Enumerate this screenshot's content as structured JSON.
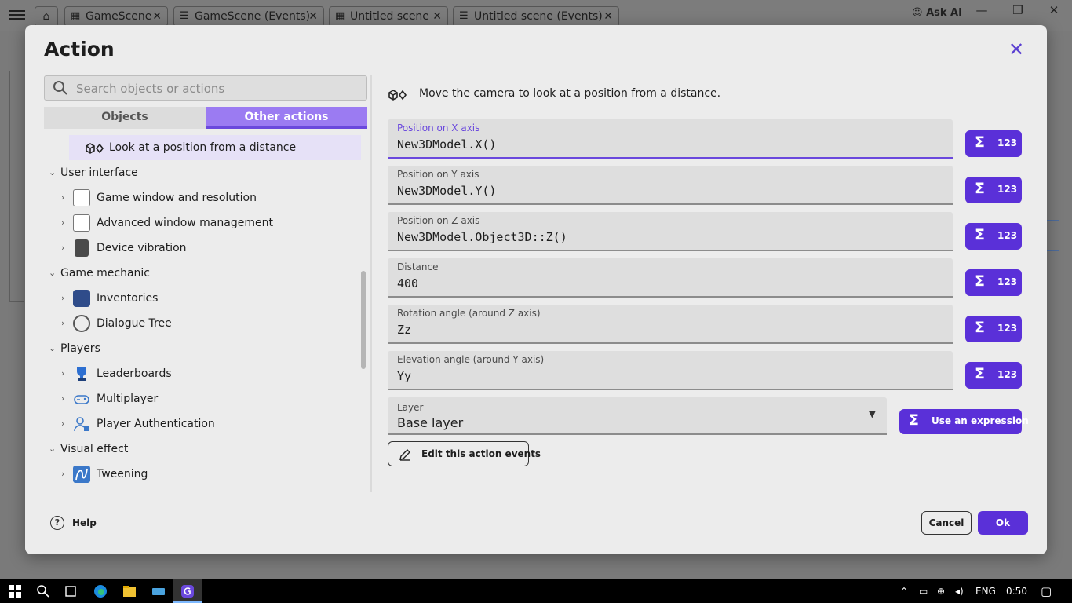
{
  "tabs": [
    {
      "label": "GameScene"
    },
    {
      "label": "GameScene (Events)"
    },
    {
      "label": "Untitled scene"
    },
    {
      "label": "Untitled scene (Events)"
    }
  ],
  "ask_ai": "Ask AI",
  "dialog": {
    "title": "Action",
    "search_placeholder": "Search objects or actions",
    "tab_objects": "Objects",
    "tab_other_actions": "Other actions",
    "tree": [
      {
        "label": "Look at a position from a distance",
        "level": "action",
        "selected": true,
        "icon": "camera-3d-icon"
      },
      {
        "label": "User interface",
        "level": "category",
        "expanded": true
      },
      {
        "label": "Game window and resolution",
        "level": "group",
        "icon": "window-icon"
      },
      {
        "label": "Advanced window management",
        "level": "group",
        "icon": "window-icon"
      },
      {
        "label": "Device vibration",
        "level": "group",
        "icon": "phone-vibrate-icon"
      },
      {
        "label": "Game mechanic",
        "level": "category",
        "expanded": true
      },
      {
        "label": "Inventories",
        "level": "group",
        "icon": "briefcase-icon"
      },
      {
        "label": "Dialogue Tree",
        "level": "group",
        "icon": "yarn-ball-icon"
      },
      {
        "label": "Players",
        "level": "category",
        "expanded": true
      },
      {
        "label": "Leaderboards",
        "level": "group",
        "icon": "trophy-icon"
      },
      {
        "label": "Multiplayer",
        "level": "group",
        "icon": "gamepad-icon"
      },
      {
        "label": "Player Authentication",
        "level": "group",
        "icon": "user-lock-icon"
      },
      {
        "label": "Visual effect",
        "level": "category",
        "expanded": true
      },
      {
        "label": "Tweening",
        "level": "group",
        "icon": "tween-icon"
      }
    ],
    "description": "Move the camera to look at a position from a distance.",
    "fields": [
      {
        "label": "Position on X axis",
        "value": "New3DModel.X()",
        "focused": true
      },
      {
        "label": "Position on Y axis",
        "value": "New3DModel.Y()"
      },
      {
        "label": "Position on Z axis",
        "value": "New3DModel.Object3D::Z()"
      },
      {
        "label": "Distance",
        "value": "400"
      },
      {
        "label": "Rotation angle (around Z axis)",
        "value": "Zz"
      },
      {
        "label": "Elevation angle (around Y axis)",
        "value": "Yy"
      }
    ],
    "expr_button_label": "123",
    "layer": {
      "label": "Layer",
      "value": "Base layer"
    },
    "use_expression": "Use an expression",
    "edit_events": "Edit this action events",
    "help": "Help",
    "cancel": "Cancel",
    "ok": "Ok"
  },
  "taskbar": {
    "language": "ENG",
    "time": "0:50"
  },
  "colors": {
    "accent": "#5a30d8",
    "tab_active": "#9b7bf2",
    "selected_row": "#e6e1f7",
    "dialog_bg": "#ececec"
  }
}
